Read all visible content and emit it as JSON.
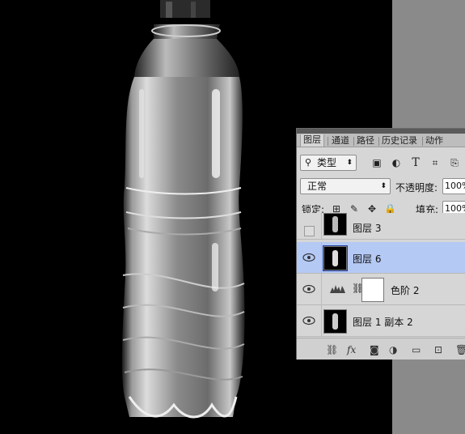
{
  "tabs": [
    {
      "label": "图层",
      "active": true
    },
    {
      "label": "通道",
      "active": false
    },
    {
      "label": "路径",
      "active": false
    },
    {
      "label": "历史记录",
      "active": false
    },
    {
      "label": "动作",
      "active": false
    }
  ],
  "filter": {
    "label": "类型"
  },
  "blend": {
    "mode": "正常",
    "opacity_label": "不透明度:",
    "opacity_value": "100%"
  },
  "lock": {
    "label": "锁定:",
    "fill_label": "填充:",
    "fill_value": "100%"
  },
  "layers": [
    {
      "name": "图层 3",
      "visible": false,
      "selected": false
    },
    {
      "name": "图层 6",
      "visible": true,
      "selected": true
    },
    {
      "name": "色阶 2",
      "visible": true,
      "selected": false
    },
    {
      "name": "图层 1 副本 2",
      "visible": true,
      "selected": false
    }
  ],
  "colors": {
    "selected_row": "#b5c9f5",
    "panel": "#d6d6d6",
    "canvas": "#000000",
    "workspace": "#8a8a8a"
  }
}
